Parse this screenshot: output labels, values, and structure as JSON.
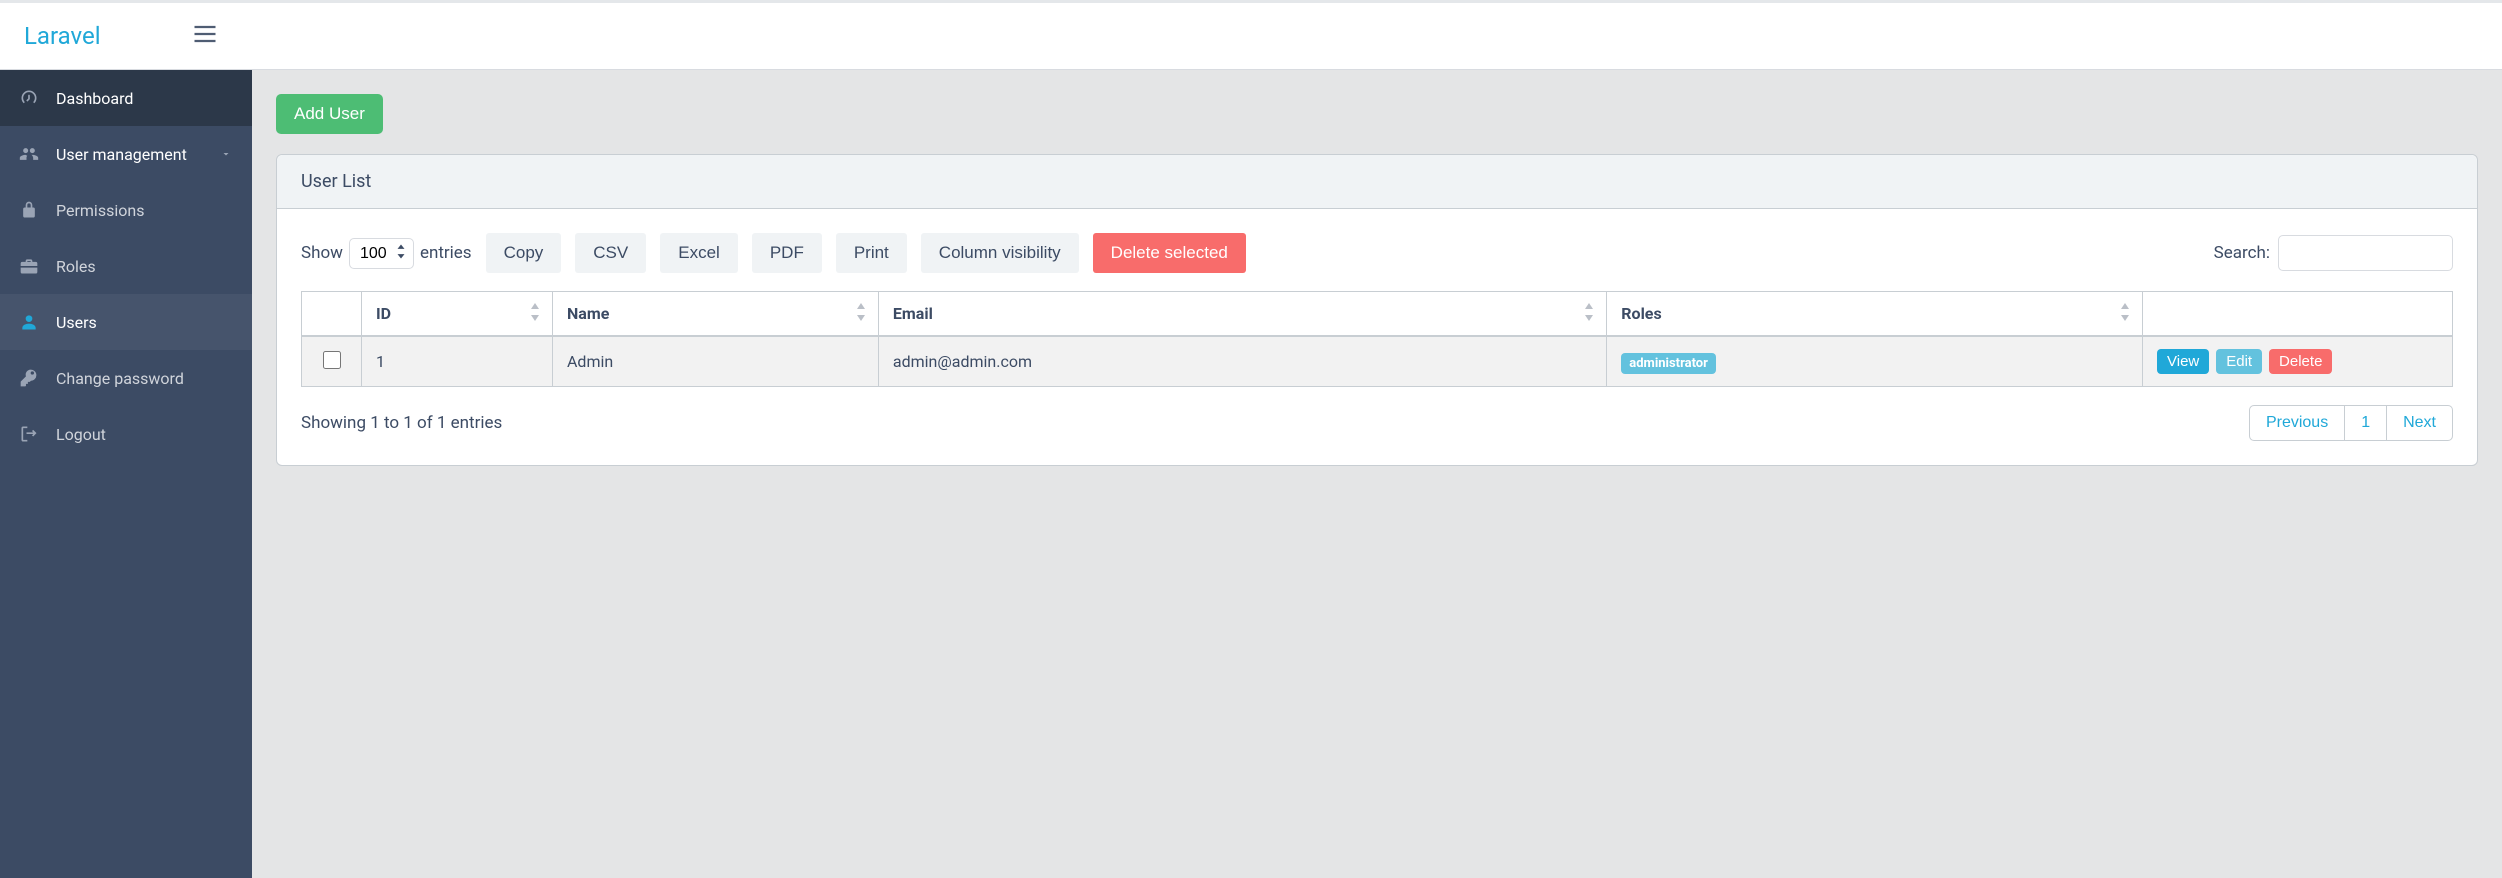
{
  "brand": "Laravel",
  "sidebar": {
    "items": [
      {
        "label": "Dashboard",
        "icon": "gauge"
      },
      {
        "label": "User management",
        "icon": "users",
        "expandable": true
      },
      {
        "label": "Permissions",
        "icon": "lock"
      },
      {
        "label": "Roles",
        "icon": "briefcase"
      },
      {
        "label": "Users",
        "icon": "user",
        "active": true
      },
      {
        "label": "Change password",
        "icon": "key"
      },
      {
        "label": "Logout",
        "icon": "logout"
      }
    ]
  },
  "main": {
    "add_user_label": "Add User",
    "card_title": "User List",
    "show_label": "Show",
    "entries_value": "100",
    "entries_label": "entries",
    "buttons": {
      "copy": "Copy",
      "csv": "CSV",
      "excel": "Excel",
      "pdf": "PDF",
      "print": "Print",
      "colvis": "Column visibility",
      "delete_selected": "Delete selected"
    },
    "search_label": "Search:",
    "search_value": "",
    "table": {
      "headers": {
        "id": "ID",
        "name": "Name",
        "email": "Email",
        "roles": "Roles"
      },
      "rows": [
        {
          "id": "1",
          "name": "Admin",
          "email": "admin@admin.com",
          "role": "administrator"
        }
      ]
    },
    "row_actions": {
      "view": "View",
      "edit": "Edit",
      "delete": "Delete"
    },
    "info": "Showing 1 to 1 of 1 entries",
    "pager": {
      "prev": "Previous",
      "page": "1",
      "next": "Next"
    }
  }
}
